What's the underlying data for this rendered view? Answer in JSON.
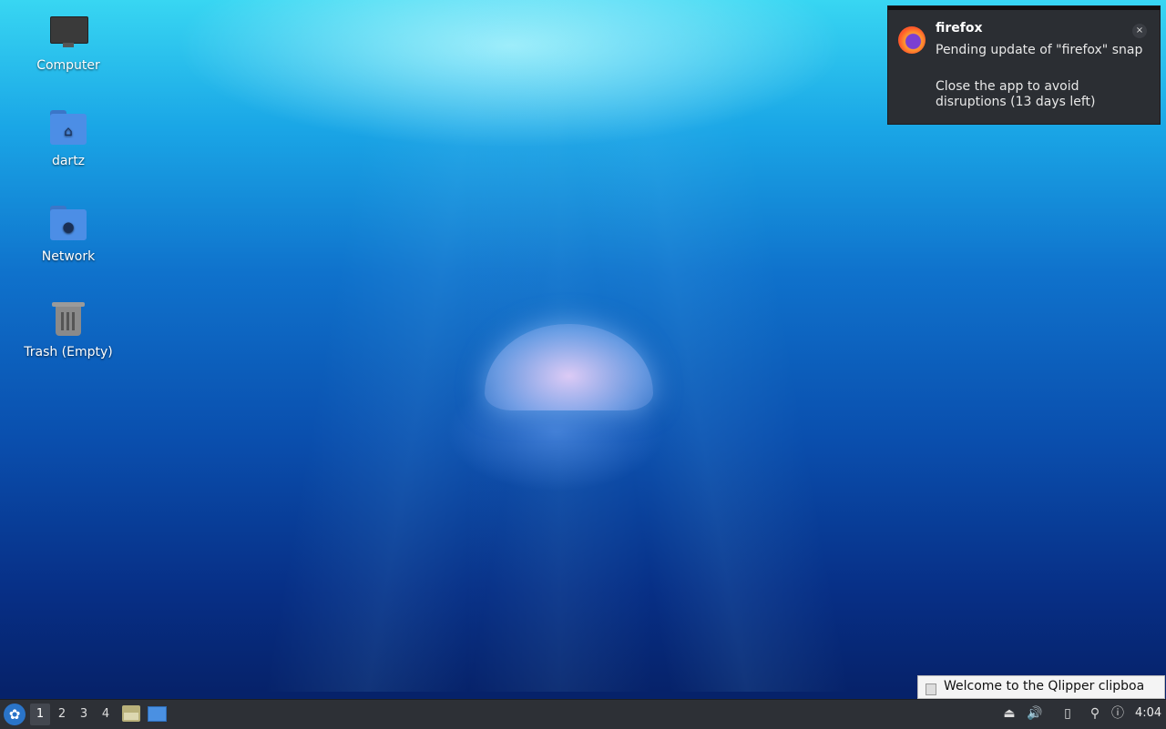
{
  "desktop": {
    "icons": [
      {
        "label": "Computer",
        "icon": "computer-icon"
      },
      {
        "label": "dartz",
        "icon": "home-folder-icon"
      },
      {
        "label": "Network",
        "icon": "network-folder-icon"
      },
      {
        "label": "Trash (Empty)",
        "icon": "trash-icon"
      }
    ]
  },
  "notification": {
    "app": "firefox",
    "icon": "firefox-icon",
    "message": "Pending update of \"firefox\" snap",
    "detail": "Close the app to avoid disruptions (13 days left)",
    "close_label": "×"
  },
  "tooltip": {
    "text": "Welcome to the Qlipper clipboa"
  },
  "taskbar": {
    "start_icon": "lubuntu-menu-icon",
    "workspaces": [
      "1",
      "2",
      "3",
      "4"
    ],
    "active_workspace": "1",
    "quicklaunch": [
      "file-manager-icon",
      "show-desktop-icon"
    ],
    "tray": [
      "eject-icon",
      "volume-icon",
      "clipboard-icon",
      "network-icon",
      "update-notifier-icon"
    ],
    "clock": "4:04"
  },
  "colors": {
    "panel": "#2d3036",
    "notification_bg": "#2b2e33",
    "folder": "#4c8ee6"
  }
}
